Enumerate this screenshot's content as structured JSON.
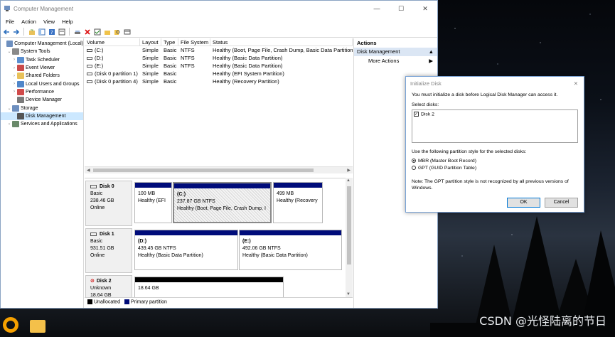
{
  "window": {
    "title": "Computer Management",
    "menu": [
      "File",
      "Action",
      "View",
      "Help"
    ]
  },
  "tree": [
    {
      "label": "Computer Management (Local)",
      "level": 0,
      "expand": "",
      "icon": "computer-icon"
    },
    {
      "label": "System Tools",
      "level": 1,
      "expand": "v",
      "icon": "tools-icon"
    },
    {
      "label": "Task Scheduler",
      "level": 2,
      "expand": ">",
      "icon": "clock-icon"
    },
    {
      "label": "Event Viewer",
      "level": 2,
      "expand": ">",
      "icon": "event-icon"
    },
    {
      "label": "Shared Folders",
      "level": 2,
      "expand": ">",
      "icon": "folder-icon"
    },
    {
      "label": "Local Users and Groups",
      "level": 2,
      "expand": ">",
      "icon": "users-icon"
    },
    {
      "label": "Performance",
      "level": 2,
      "expand": ">",
      "icon": "performance-icon"
    },
    {
      "label": "Device Manager",
      "level": 2,
      "expand": "",
      "icon": "device-icon"
    },
    {
      "label": "Storage",
      "level": 1,
      "expand": "v",
      "icon": "storage-icon"
    },
    {
      "label": "Disk Management",
      "level": 2,
      "expand": "",
      "icon": "disk-icon",
      "selected": true
    },
    {
      "label": "Services and Applications",
      "level": 1,
      "expand": ">",
      "icon": "services-icon"
    }
  ],
  "volumes": {
    "headers": [
      "Volume",
      "Layout",
      "Type",
      "File System",
      "Status"
    ],
    "rows": [
      [
        "(C:)",
        "Simple",
        "Basic",
        "NTFS",
        "Healthy (Boot, Page File, Crash Dump, Basic Data Partition)"
      ],
      [
        "(D:)",
        "Simple",
        "Basic",
        "NTFS",
        "Healthy (Basic Data Partition)"
      ],
      [
        "(E:)",
        "Simple",
        "Basic",
        "NTFS",
        "Healthy (Basic Data Partition)"
      ],
      [
        "(Disk 0 partition 1)",
        "Simple",
        "Basic",
        "",
        "Healthy (EFI System Partition)"
      ],
      [
        "(Disk 0 partition 4)",
        "Simple",
        "Basic",
        "",
        "Healthy (Recovery Partition)"
      ]
    ]
  },
  "disks": {
    "disk0": {
      "name": "Disk 0",
      "type": "Basic",
      "size": "238.46 GB",
      "status": "Online",
      "p1": {
        "size": "100 MB",
        "status": "Healthy (EFI"
      },
      "p2": {
        "name": "(C:)",
        "size": "237.87 GB NTFS",
        "status": "Healthy (Boot, Page File, Crash Dump, I"
      },
      "p3": {
        "size": "499 MB",
        "status": "Healthy (Recovery"
      }
    },
    "disk1": {
      "name": "Disk 1",
      "type": "Basic",
      "size": "931.51 GB",
      "status": "Online",
      "p1": {
        "name": "(D:)",
        "size": "439.45 GB NTFS",
        "status": "Healthy (Basic Data Partition)"
      },
      "p2": {
        "name": "(E:)",
        "size": "492.06 GB NTFS",
        "status": "Healthy (Basic Data Partition)"
      }
    },
    "disk2": {
      "name": "Disk 2",
      "type": "Unknown",
      "size": "18.64 GB",
      "status": "",
      "p1": {
        "size": "18.64 GB"
      }
    }
  },
  "legend": {
    "unallocated": "Unallocated",
    "primary": "Primary partition"
  },
  "actions": {
    "header": "Actions",
    "section": "Disk Management",
    "more": "More Actions"
  },
  "dialog": {
    "title": "Initialize Disk",
    "intro": "You must initialize a disk before Logical Disk Manager can access it.",
    "select_label": "Select disks:",
    "disk_item": "Disk 2",
    "style_label": "Use the following partition style for the selected disks:",
    "mbr": "MBR (Master Boot Record)",
    "gpt": "GPT (GUID Partition Table)",
    "note": "Note: The GPT partition style is not recognized by all previous versions of Windows.",
    "ok": "OK",
    "cancel": "Cancel"
  },
  "watermark": "CSDN @光怪陆离的节日",
  "colors": {
    "primary_partition": "#000c7a",
    "unallocated": "#000000",
    "selection": "#cce8ff"
  }
}
